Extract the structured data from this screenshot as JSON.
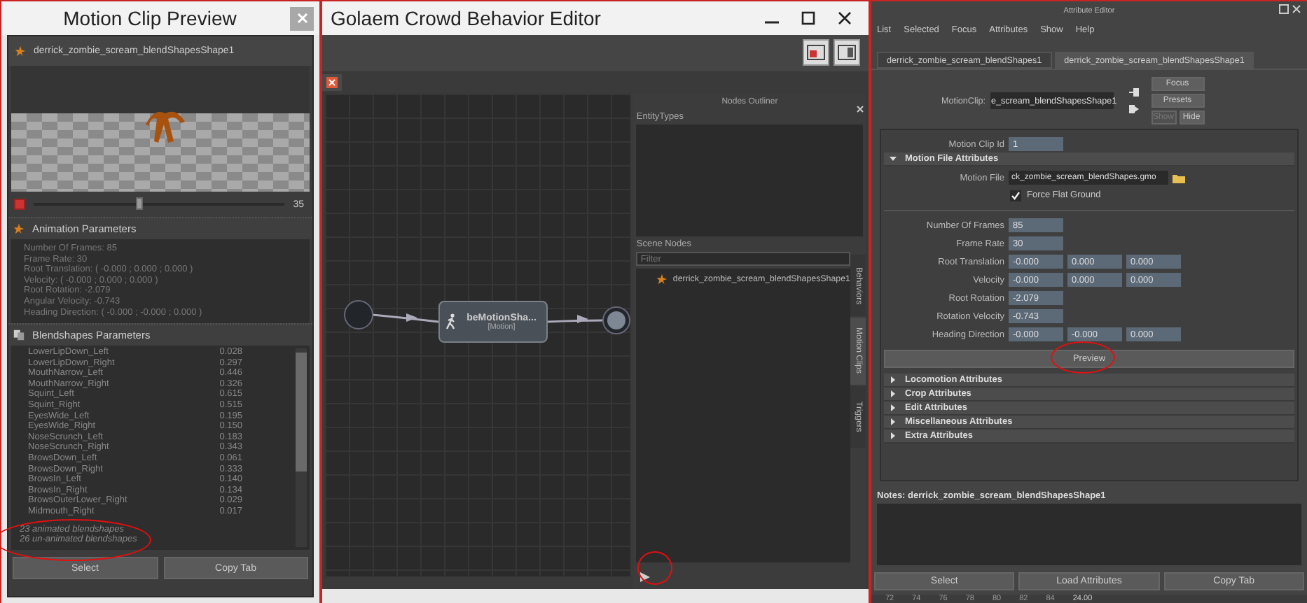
{
  "preview_window": {
    "title": "Motion Clip Preview",
    "clip_name": "derrick_zombie_scream_blendShapesShape1",
    "playback": {
      "level": 0.42,
      "frame": "35"
    },
    "animation_parameters": {
      "title": "Animation Parameters",
      "lines": [
        "Number Of Frames: 85",
        "Frame Rate: 30",
        "Root Translation: ( -0.000 ; 0.000 ; 0.000 )",
        "Velocity: ( -0.000 ; 0.000 ; 0.000 )",
        "Root Rotation: -2.079",
        "Angular Velocity: -0.743",
        "Heading Direction: ( -0.000 ; -0.000 ; 0.000 )"
      ]
    },
    "blendshapes": {
      "title": "Blendshapes Parameters",
      "rows": [
        {
          "name": "LowerLipDown_Left",
          "value": "0.028"
        },
        {
          "name": "LowerLipDown_Right",
          "value": "0.297"
        },
        {
          "name": "MouthNarrow_Left",
          "value": "0.446"
        },
        {
          "name": "MouthNarrow_Right",
          "value": "0.326"
        },
        {
          "name": "Squint_Left",
          "value": "0.615"
        },
        {
          "name": "Squint_Right",
          "value": "0.515"
        },
        {
          "name": "EyesWide_Left",
          "value": "0.195"
        },
        {
          "name": "EyesWide_Right",
          "value": "0.150"
        },
        {
          "name": "NoseScrunch_Left",
          "value": "0.183"
        },
        {
          "name": "NoseScrunch_Right",
          "value": "0.343"
        },
        {
          "name": "BrowsDown_Left",
          "value": "0.061"
        },
        {
          "name": "BrowsDown_Right",
          "value": "0.333"
        },
        {
          "name": "BrowsIn_Left",
          "value": "0.140"
        },
        {
          "name": "BrowsIn_Right",
          "value": "0.134"
        },
        {
          "name": "BrowsOuterLower_Right",
          "value": "0.029"
        },
        {
          "name": "Midmouth_Right",
          "value": "0.017"
        }
      ],
      "summary": [
        "23 animated blendshapes",
        "26 un-animated blendshapes"
      ]
    },
    "buttons": [
      "Select",
      "Copy Tab"
    ]
  },
  "behavior_editor": {
    "title": "Golaem Crowd Behavior Editor",
    "node": {
      "title": "beMotionSha...",
      "subtitle": "[Motion]"
    },
    "outliner": {
      "title": "Nodes Outliner",
      "entity_types_label": "EntityTypes",
      "scene_nodes_label": "Scene Nodes",
      "filter_placeholder": "Filter",
      "items": [
        "derrick_zombie_scream_blendShapesShape1"
      ],
      "side_tabs": [
        {
          "label": "Behaviors",
          "selected": false
        },
        {
          "label": "Motion Clips",
          "selected": true
        },
        {
          "label": "Triggers",
          "selected": false
        }
      ]
    }
  },
  "attribute_editor": {
    "title": "Attribute Editor",
    "menu": [
      "List",
      "Selected",
      "Focus",
      "Attributes",
      "Show",
      "Help"
    ],
    "tabs": [
      {
        "label": "derrick_zombie_scream_blendShapes1",
        "selected": false
      },
      {
        "label": "derrick_zombie_scream_blendShapesShape1",
        "selected": true
      }
    ],
    "motion_clip": {
      "label": "MotionClip:",
      "value": "e_scream_blendShapesShape1"
    },
    "side_buttons": [
      {
        "label": "Focus",
        "disabled": false
      },
      {
        "label": "Presets",
        "disabled": false
      },
      {
        "label": "Show",
        "disabled": true
      },
      {
        "label": "Hide",
        "disabled": false
      }
    ],
    "motion_clip_id": {
      "label": "Motion Clip Id",
      "value": "1"
    },
    "sections": [
      {
        "title": "Motion File Attributes",
        "expanded": true,
        "motion_file": {
          "label": "Motion File",
          "value": "ck_zombie_scream_blendShapes.gmo"
        },
        "force_flat_ground": {
          "label": "Force Flat Ground",
          "checked": true
        },
        "fields": [
          {
            "label": "Number Of Frames",
            "values": [
              "85"
            ]
          },
          {
            "label": "Frame Rate",
            "values": [
              "30"
            ]
          },
          {
            "label": "Root Translation",
            "values": [
              "-0.000",
              "0.000",
              "0.000"
            ]
          },
          {
            "label": "Velocity",
            "values": [
              "-0.000",
              "0.000",
              "0.000"
            ]
          },
          {
            "label": "Root Rotation",
            "values": [
              "-2.079"
            ]
          },
          {
            "label": "Rotation Velocity",
            "values": [
              "-0.743"
            ]
          },
          {
            "label": "Heading Direction",
            "values": [
              "-0.000",
              "-0.000",
              "0.000"
            ]
          }
        ],
        "preview_button": "Preview"
      },
      {
        "title": "Locomotion Attributes",
        "expanded": false
      },
      {
        "title": "Crop Attributes",
        "expanded": false
      },
      {
        "title": "Edit Attributes",
        "expanded": false
      },
      {
        "title": "Miscellaneous Attributes",
        "expanded": false
      },
      {
        "title": "Extra Attributes",
        "expanded": false
      }
    ],
    "notes_label": "Notes:  derrick_zombie_scream_blendShapesShape1",
    "buttons": [
      "Select",
      "Load Attributes",
      "Copy Tab"
    ],
    "timeline": {
      "ticks": [
        "72",
        "74",
        "76",
        "78",
        "80",
        "82",
        "84"
      ],
      "current": "24.00"
    }
  }
}
